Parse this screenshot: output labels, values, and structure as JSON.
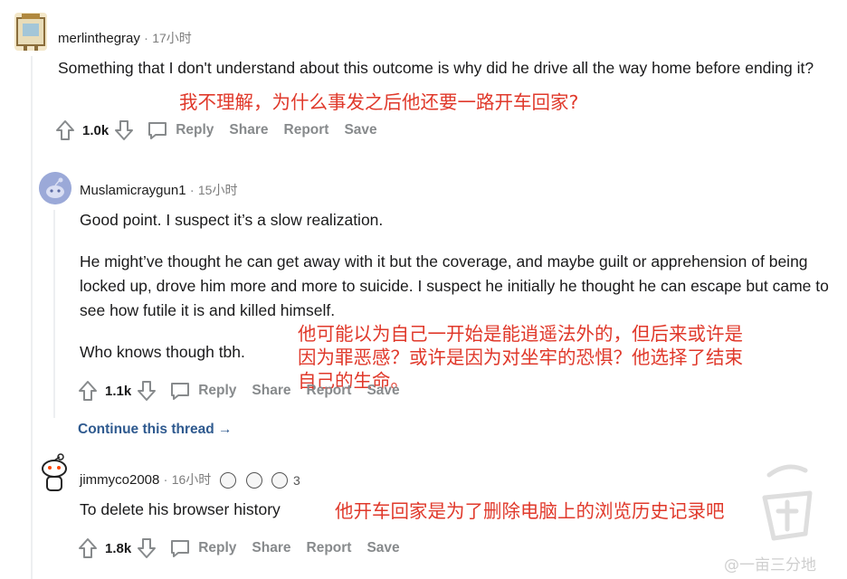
{
  "comments": [
    {
      "username": "merlinthegray",
      "time": "17小时",
      "body": [
        "Something that I don't understand about this outcome is why did he drive all the way home before ending it?"
      ],
      "votes": "1.0k",
      "annotation": "我不理解，为什么事发之后他还要一路开车回家?"
    },
    {
      "username": "Muslamicraygun1",
      "time": "15小时",
      "body": [
        "Good point. I suspect it’s a slow realization.",
        "He might’ve thought he can get away with it but the coverage, and maybe guilt or apprehension of being locked up, drove him more and more to suicide. I suspect he initially he thought he can escape but came to see how futile it is and killed himself.",
        "Who knows though tbh."
      ],
      "votes": "1.1k",
      "annotation_lines": [
        "他可能以为自己一开始是能逍遥法外的，但后来或许是",
        "因为罪恶感？或许是因为对坐牢的恐惧？他选择了结束",
        "自己的生命。"
      ],
      "continue": "Continue this thread →"
    },
    {
      "username": "jimmyco2008",
      "time": "16小时",
      "award_count": "3",
      "body": [
        "To delete his browser history"
      ],
      "votes": "1.8k",
      "annotation": "他开车回家是为了删除电脑上的浏览历史记录吧"
    }
  ],
  "actions": {
    "reply": "Reply",
    "share": "Share",
    "report": "Report",
    "save": "Save"
  },
  "separator": "·",
  "watermark": "@一亩三分地"
}
